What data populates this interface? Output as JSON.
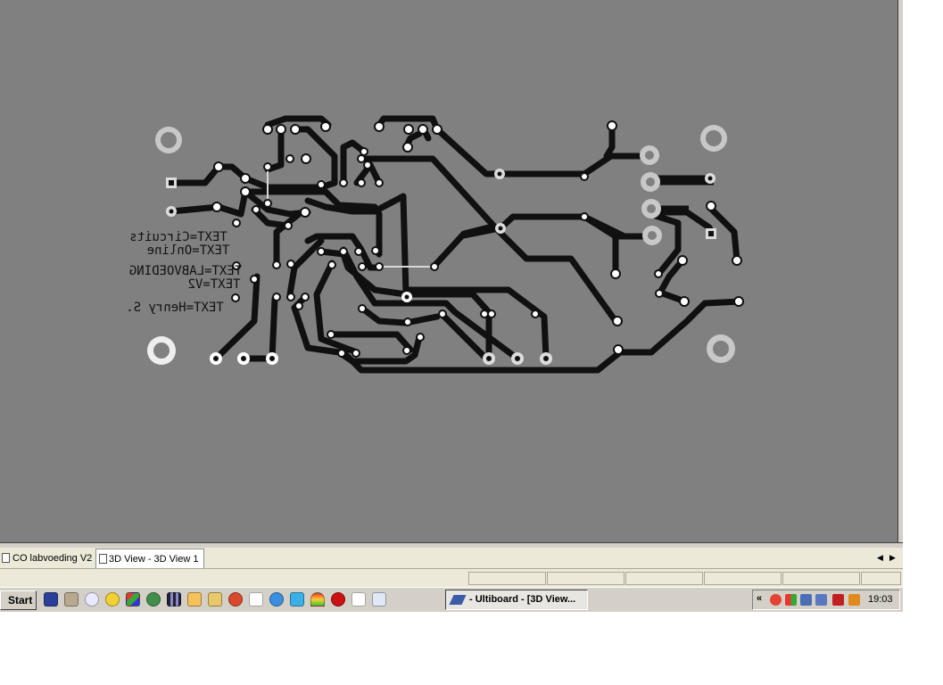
{
  "window": {
    "title": "Ultiboard - [3D View - 3D View 1]"
  },
  "pcb": {
    "silkscreen_texts": [
      "TEXT=Circuits",
      "TEXT=Online",
      "TEXT=LABVOEDING",
      "TEXT=V2",
      "TEXT=Henry S."
    ],
    "colors": {
      "background": "#808080",
      "copper": "#101010",
      "pad": "#ffffff",
      "mounting_ring": "#c8c8c8"
    }
  },
  "document_tabs": [
    {
      "label": "CO labvoeding V2",
      "active": false
    },
    {
      "label": "3D View - 3D View 1",
      "active": true
    }
  ],
  "tab_nav": {
    "prev": "◀",
    "next": "▶"
  },
  "taskbar": {
    "start_label": "Start",
    "tasks": [
      {
        "label": "- Ultiboard - [3D View..."
      }
    ],
    "tray_chevron": "«",
    "clock": "19:03"
  },
  "icons": {
    "quick_launch": [
      "save-icon",
      "hand-icon",
      "media-player-icon",
      "smiley-icon",
      "paint-icon",
      "globe-icon",
      "grid-icon",
      "clock-icon",
      "folder-icon",
      "firefox-icon",
      "cursor-icon",
      "internet-explorer-icon",
      "skype-icon",
      "rainbow-icon",
      "red-bug-icon",
      "notepad-icon",
      "window-icon"
    ],
    "tray": [
      "chrome-icon",
      "windows-flag-icon",
      "network-icon",
      "monitor-icon",
      "red-device-icon",
      "m-app-icon"
    ]
  }
}
